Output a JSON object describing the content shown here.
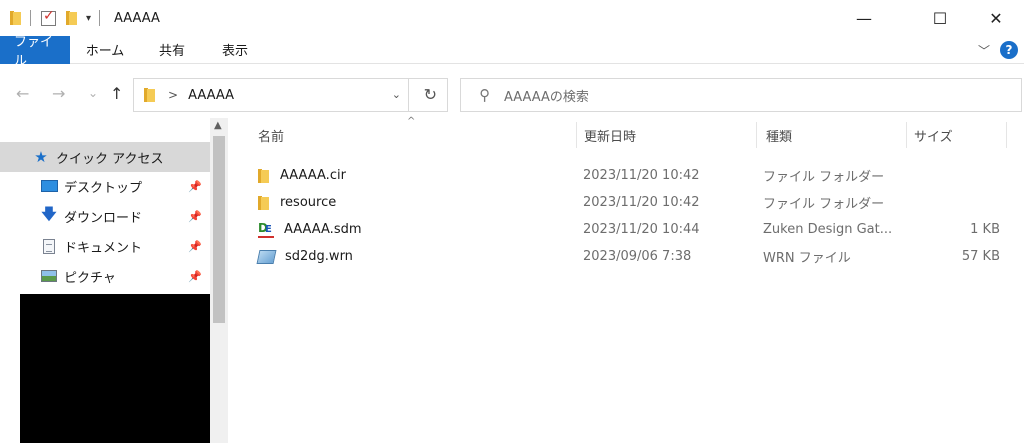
{
  "window": {
    "title": "AAAAA",
    "controls": {
      "minimize": "—",
      "maximize": "☐",
      "close": "✕"
    }
  },
  "ribbon": {
    "tabs": [
      {
        "label": "ファイル",
        "active": true
      },
      {
        "label": "ホーム"
      },
      {
        "label": "共有"
      },
      {
        "label": "表示"
      }
    ],
    "expand_icon": "chevron-down-icon",
    "help_label": "?"
  },
  "nav": {
    "back": "←",
    "forward": "→",
    "recent": "⌄",
    "up": "↑"
  },
  "address": {
    "separator": ">",
    "path": "AAAAA",
    "dropdown": "⌄",
    "refresh": "↻"
  },
  "search": {
    "placeholder": "AAAAAの検索"
  },
  "sidebar": {
    "items": [
      {
        "label": "クイック アクセス",
        "icon": "star-icon",
        "selected": true
      },
      {
        "label": "デスクトップ",
        "icon": "desktop-icon",
        "pinned": true
      },
      {
        "label": "ダウンロード",
        "icon": "download-icon",
        "pinned": true
      },
      {
        "label": "ドキュメント",
        "icon": "document-icon",
        "pinned": true
      },
      {
        "label": "ピクチャ",
        "icon": "pictures-icon",
        "pinned": true
      }
    ],
    "pin_glyph": "📌"
  },
  "files": {
    "columns": {
      "name": "名前",
      "date": "更新日時",
      "type": "種類",
      "size": "サイズ"
    },
    "sort_indicator": "^",
    "rows": [
      {
        "name": "AAAAA.cir",
        "date": "2023/11/20 10:42",
        "type": "ファイル フォルダー",
        "size": "",
        "icon": "folder-icon"
      },
      {
        "name": "resource",
        "date": "2023/11/20 10:42",
        "type": "ファイル フォルダー",
        "size": "",
        "icon": "folder-icon"
      },
      {
        "name": "AAAAA.sdm",
        "date": "2023/11/20 10:44",
        "type": "Zuken Design Gat...",
        "size": "1 KB",
        "icon": "sdm-file-icon"
      },
      {
        "name": "sd2dg.wrn",
        "date": "2023/09/06 7:38",
        "type": "WRN ファイル",
        "size": "57 KB",
        "icon": "wrn-file-icon"
      }
    ]
  }
}
